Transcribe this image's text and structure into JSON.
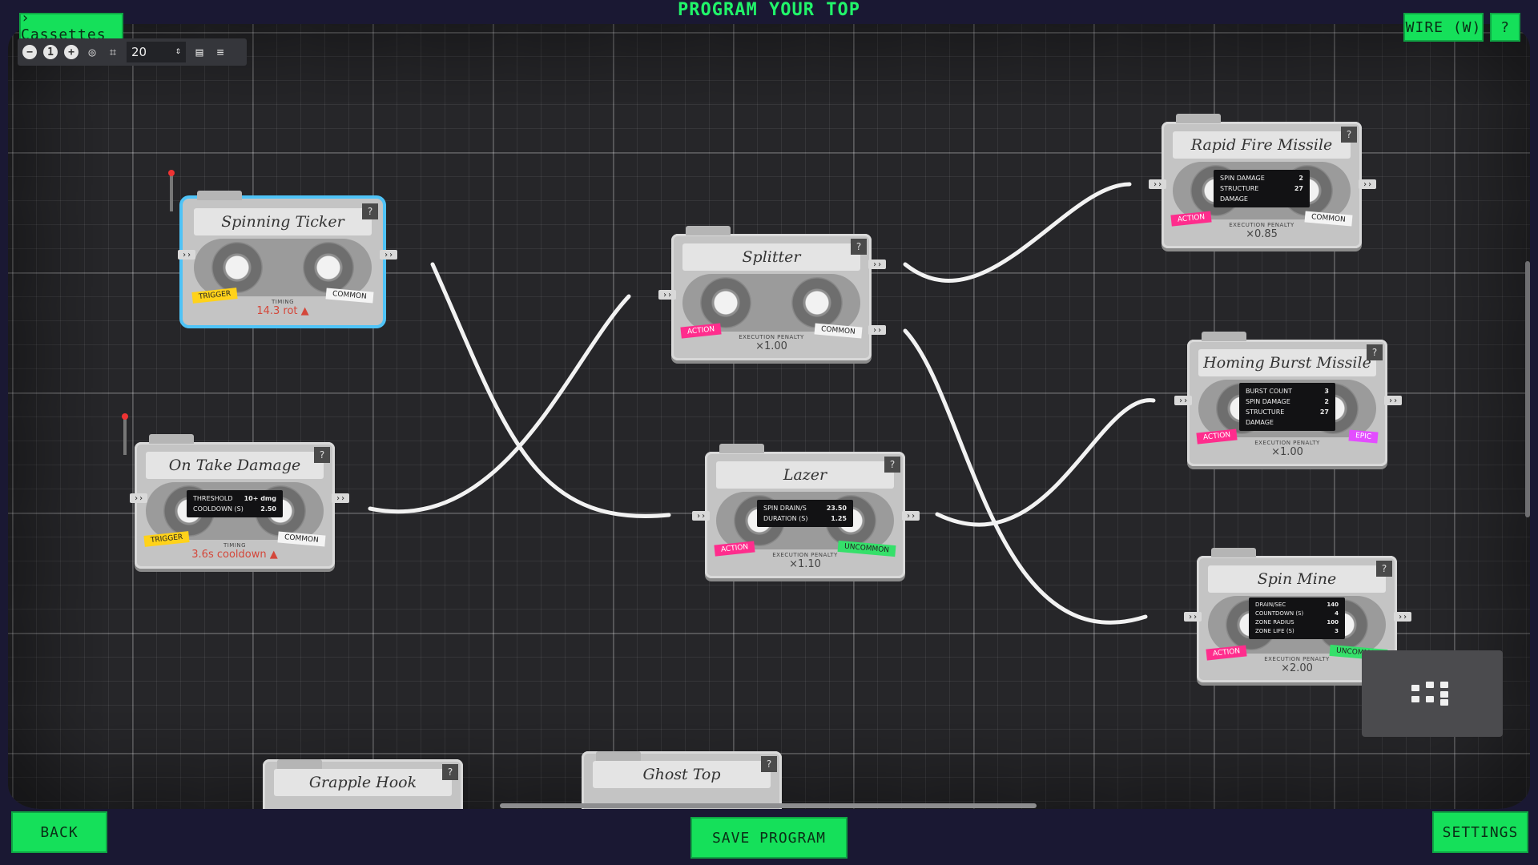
{
  "header": {
    "title": "PROGRAM YOUR TOP"
  },
  "top_left": {
    "cassettes_button": "› Cassettes"
  },
  "top_right": {
    "wire_button": "WIRE (W)",
    "help_button": "?"
  },
  "toolbar": {
    "zoom_value": "20"
  },
  "bottom": {
    "back_button": "BACK",
    "save_button": "SAVE PROGRAM",
    "settings_button": "SETTINGS"
  },
  "cassettes": [
    {
      "name": "Spinning Ticker",
      "type": "TRIGGER",
      "rarity": "COMMON",
      "caption": "TIMING",
      "value": "14.3 rot ▲"
    },
    {
      "name": "On Take Damage",
      "type": "TRIGGER",
      "rarity": "COMMON",
      "caption": "TIMING",
      "value": "3.6s cooldown ▲",
      "stats": [
        {
          "k": "THRESHOLD",
          "v": "10+ dmg"
        },
        {
          "k": "COOLDOWN (S)",
          "v": "2.50"
        }
      ]
    },
    {
      "name": "Splitter",
      "type": "ACTION",
      "rarity": "COMMON",
      "caption": "EXECUTION PENALTY",
      "value": "×1.00"
    },
    {
      "name": "Lazer",
      "type": "ACTION",
      "rarity": "UNCOMMON",
      "caption": "EXECUTION PENALTY",
      "value": "×1.10",
      "stats": [
        {
          "k": "SPIN DRAIN/S",
          "v": "23.50"
        },
        {
          "k": "DURATION (S)",
          "v": "1.25"
        }
      ]
    },
    {
      "name": "Rapid Fire Missile",
      "type": "ACTION",
      "rarity": "COMMON",
      "caption": "EXECUTION PENALTY",
      "value": "×0.85",
      "stats": [
        {
          "k": "SPIN DAMAGE",
          "v": "2"
        },
        {
          "k": "STRUCTURE DAMAGE",
          "v": "27"
        }
      ]
    },
    {
      "name": "Homing Burst Missile",
      "type": "ACTION",
      "rarity": "EPIC",
      "caption": "EXECUTION PENALTY",
      "value": "×1.00",
      "stats": [
        {
          "k": "BURST COUNT",
          "v": "3"
        },
        {
          "k": "SPIN DAMAGE",
          "v": "2"
        },
        {
          "k": "STRUCTURE DAMAGE",
          "v": "27"
        }
      ]
    },
    {
      "name": "Spin Mine",
      "type": "ACTION",
      "rarity": "UNCOMMON",
      "caption": "EXECUTION PENALTY",
      "value": "×2.00",
      "stats": [
        {
          "k": "DRAIN/SEC",
          "v": "140"
        },
        {
          "k": "COUNTDOWN (S)",
          "v": "4"
        },
        {
          "k": "ZONE RADIUS",
          "v": "100"
        },
        {
          "k": "ZONE LIFE (S)",
          "v": "3"
        }
      ]
    },
    {
      "name": "Grapple Hook"
    },
    {
      "name": "Ghost Top"
    }
  ],
  "colors": {
    "accent_green": "#15e05a",
    "trigger": "#ffd21a",
    "action": "#ff2d8d",
    "uncommon": "#35e06a",
    "epic": "#e34dff",
    "selected_outline": "#4fc3f7"
  }
}
